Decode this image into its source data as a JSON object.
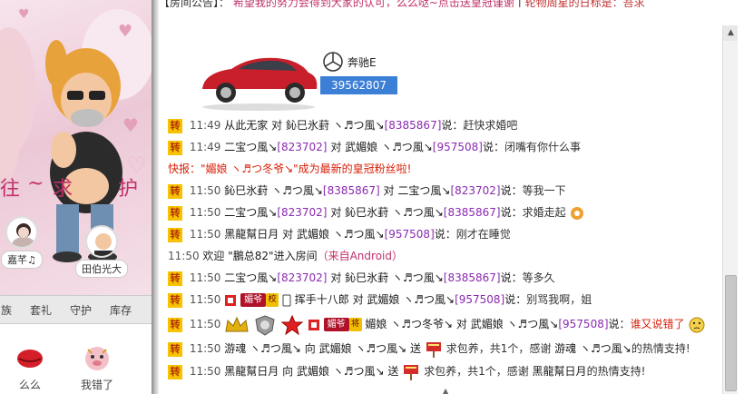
{
  "notice": {
    "prefix": "【房间公告】：",
    "text_main": "希望我的努力会得到大家的认可，么么哒~点击送皇冠谨谢",
    "sep": "|",
    "text_tail": "轮物周星的日标是：吾求"
  },
  "left_panel": {
    "banner_chars": [
      "往",
      "~",
      "求",
      "护"
    ],
    "avatars": [
      {
        "name": "嘉芊♫"
      },
      {
        "name": "田伯光大"
      }
    ],
    "tabs": [
      "族",
      "套礼",
      "守护",
      "库存"
    ],
    "gifts": [
      {
        "label": "么么",
        "icon": "kiss-lips-icon"
      },
      {
        "label": "我错了",
        "icon": "sorry-pig-icon"
      }
    ]
  },
  "car_card": {
    "brand_icon": "mercedes-logo-icon",
    "name": "奔驰E",
    "id": "39562807"
  },
  "messages": {
    "m1": {
      "badge": "转",
      "time": "11:49",
      "user": "从此无家",
      "mid": "对",
      "target": "鈊巳氷葑 ヽ♬つ風↘",
      "target_id": "[8385867]",
      "verb": "说：",
      "text": "赶快求婚吧"
    },
    "m2": {
      "badge": "转",
      "time": "11:49",
      "user": "二宝つ風↘",
      "user_id": "[823702]",
      "mid": "对",
      "target": "武媚娘 ヽ♬つ風↘",
      "target_id": "[957508]",
      "verb": "说：",
      "text": "闭嘴有你什么事"
    },
    "m3": {
      "label": "快报：",
      "text": "\"媚娘 ヽ♬つ冬爷↘\"成为最新的皇冠粉丝啦!"
    },
    "m4": {
      "badge": "转",
      "time": "11:50",
      "user": "鈊巳氷葑 ヽ♬つ風↘",
      "user_id": "[8385867]",
      "mid": "对",
      "target": "二宝つ風↘",
      "target_id": "[823702]",
      "verb": "说：",
      "text": "等我一下"
    },
    "m5": {
      "badge": "转",
      "time": "11:50",
      "user": "二宝つ風↘",
      "user_id": "[823702]",
      "mid": "对",
      "target": "鈊巳氷葑 ヽ♬つ風↘",
      "target_id": "[8385867]",
      "verb": "说：",
      "text": "求婚走起"
    },
    "m6": {
      "badge": "转",
      "time": "11:50",
      "user": "黑龍幫日月",
      "mid": "对",
      "target": "武媚娘 ヽ♬つ風↘",
      "target_id": "[957508]",
      "verb": "说：",
      "text": "刚才在睡觉"
    },
    "m7": {
      "time": "11:50",
      "pre": "欢迎",
      "user": "\"鵬总82\"",
      "post": "进入房间",
      "device": "（来自Android）"
    },
    "m8": {
      "badge": "转",
      "time": "11:50",
      "user": "二宝つ風↘",
      "user_id": "[823702]",
      "mid": "对",
      "target": "鈊巳氷葑 ヽ♬つ風↘",
      "target_id": "[8385867]",
      "verb": "说：",
      "text": "等多久"
    },
    "m9": {
      "badge": "转",
      "time": "11:50",
      "tag": "媚爷",
      "mini": "校",
      "user": "挥手十八郎",
      "mid": "对",
      "target": "武媚娘 ヽ♬つ風↘",
      "target_id": "[957508]",
      "verb": "说：",
      "text": "别骂我啊，姐"
    },
    "m10": {
      "badge": "转",
      "time": "11:50",
      "tag": "媚爷",
      "mini": "将",
      "user": "媚娘 ヽ♬つ冬爷↘",
      "mid": "对",
      "target": "武媚娘 ヽ♬つ風↘",
      "target_id": "[957508]",
      "verb": "说：",
      "text": "谁又说错了"
    },
    "m11": {
      "badge": "转",
      "time": "11:50",
      "user": "游魂 ヽ♬つ風↘",
      "mid": "向",
      "target": "武媚娘 ヽ♬つ風↘",
      "send": "送",
      "gift_text": "求包养，共1个，感谢",
      "thanks_user": "游魂 ヽ♬つ風↘",
      "thanks": "的热情支持!"
    },
    "m12": {
      "badge": "转",
      "time": "11:50",
      "user": "黑龍幫日月",
      "mid": "向",
      "target": "武媚娘 ヽ♬つ風↘",
      "send": "送",
      "gift_text": "求包养，共1个，感谢",
      "thanks_user": "黑龍幫日月",
      "thanks": "的热情支持!"
    }
  },
  "colors": {
    "accent_yellow": "#f7c300",
    "id_purple": "#8a2ab0",
    "alert_red": "#d81e06",
    "pink_bg": "#f3dde6"
  }
}
